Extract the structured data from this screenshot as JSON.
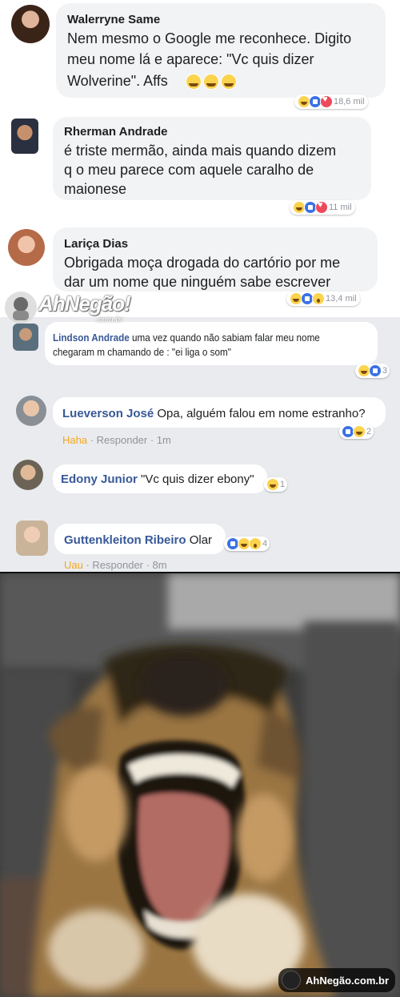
{
  "comments_top": [
    {
      "name": "Walerryne Same",
      "lines": [
        "Nem mesmo o Google me reconhece. Digito",
        "meu nome lá e aparece: \"Vc quis dizer",
        "Wolverine\". Affs"
      ],
      "reactions": [
        "haha",
        "like",
        "love"
      ],
      "count": "18,6 mil"
    },
    {
      "name": "Rherman Andrade",
      "lines": [
        "é triste mermão, ainda mais quando dizem",
        "q o meu parece com aquele caralho de",
        "maionese"
      ],
      "reactions": [
        "haha",
        "like",
        "love"
      ],
      "count": "11 mil"
    },
    {
      "name": "Lariça Dias",
      "lines": [
        "Obrigada moça drogada do cartório por me",
        "dar um nome que ninguém sabe escrever"
      ],
      "reactions": [
        "haha",
        "like",
        "wow"
      ],
      "count": "13,4 mil"
    }
  ],
  "comments_small": [
    {
      "name": "Lindson Andrade",
      "text": "uma vez quando não sabiam falar meu nome",
      "text2": "chegaram m chamando de : \"ei liga o som\"",
      "reactions": [
        "haha",
        "like"
      ],
      "count": "3"
    },
    {
      "name": "Lueverson José",
      "text": "Opa, alguém falou em nome estranho?",
      "reactions": [
        "like",
        "haha"
      ],
      "count": "2",
      "meta_react": "Haha",
      "meta_rest": " · Responder · 1m"
    },
    {
      "name": "Edony Junior",
      "text": "\"Vc quis dizer ebony\"",
      "reactions": [
        "haha"
      ],
      "count": "1"
    },
    {
      "name": "Guttenkleiton Ribeiro",
      "text": "Olar",
      "reactions": [
        "like",
        "haha",
        "wow"
      ],
      "count": "4",
      "meta_react": "Uau",
      "meta_rest": " · Responder · 8m"
    }
  ],
  "watermark": {
    "brand": "AhNegão!",
    "domain": ".com.br",
    "footer": "AhNegão.com.br"
  }
}
